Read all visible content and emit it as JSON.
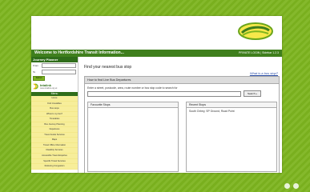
{
  "frame": {
    "accent_color": "#7db51f",
    "carousel_dots": 2
  },
  "logo": {
    "alt": "Intalink logo"
  },
  "header": {
    "title": "Welcome to Hertfordshire Transit Information...",
    "links": "PRIVATE LOGIN | Sidebar 1.2.3"
  },
  "sidebar": {
    "section_title": "Journey Planner",
    "from_label": "From",
    "to_label": "To",
    "submit_label": "Submit",
    "brand_name": "Intalink",
    "brand_sub": "www.intalink.org.uk",
    "menu_title": "Menu",
    "menu_items": [
      "Home",
      "Find timetables",
      "Bus stops",
      "Where's my bus?",
      "Timetables",
      "Bus Journey Planning",
      "Departures",
      "Travel Guide Services",
      "Maps",
      "Travel Office Information",
      "Disability Services",
      "Accessible Travel Enquiries",
      "Specific Travel Services",
      "Reducing Congestion"
    ]
  },
  "main": {
    "page_title": "Find your nearest bus stop",
    "help_link": "What is a bus stop?",
    "panel_title": "How to find Live Bus Departures",
    "instructions": "Enter a street, postcode, area, route number or bus stop code to search for",
    "search_value": "",
    "search_button": "Search »",
    "favourites_title": "Favourite Stops",
    "recent_title": "Recent Stops",
    "recent_items": [
      "South Oxhey, SP Ground, Road Point"
    ]
  }
}
